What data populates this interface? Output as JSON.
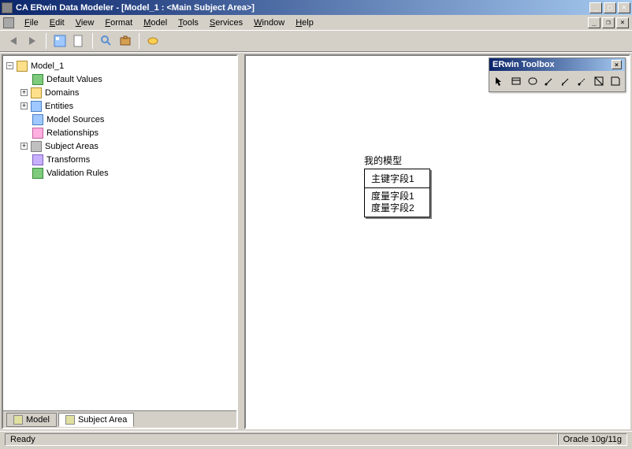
{
  "title": "CA ERwin Data Modeler - [Model_1 : <Main Subject Area>]",
  "menu": [
    "File",
    "Edit",
    "View",
    "Format",
    "Model",
    "Tools",
    "Services",
    "Window",
    "Help"
  ],
  "tree": {
    "root": "Model_1",
    "items": [
      {
        "label": "Default Values",
        "exp": null,
        "icon": "ic-green"
      },
      {
        "label": "Domains",
        "exp": "+",
        "icon": "ic-folder"
      },
      {
        "label": "Entities",
        "exp": "+",
        "icon": "ic-grid"
      },
      {
        "label": "Model Sources",
        "exp": null,
        "icon": "ic-grid"
      },
      {
        "label": "Relationships",
        "exp": null,
        "icon": "ic-rel"
      },
      {
        "label": "Subject Areas",
        "exp": "+",
        "icon": "ic-gray"
      },
      {
        "label": "Transforms",
        "exp": null,
        "icon": "ic-purple"
      },
      {
        "label": "Validation Rules",
        "exp": null,
        "icon": "ic-green"
      }
    ]
  },
  "tabs": {
    "model": "Model",
    "subject_area": "Subject Area"
  },
  "toolbox": {
    "title": "ERwin Toolbox"
  },
  "entity": {
    "title": "我的模型",
    "pk": "主键字段1",
    "attrs": [
      "度量字段1",
      "度量字段2"
    ]
  },
  "status": {
    "left": "Ready",
    "right": "Oracle 10g/11g"
  }
}
